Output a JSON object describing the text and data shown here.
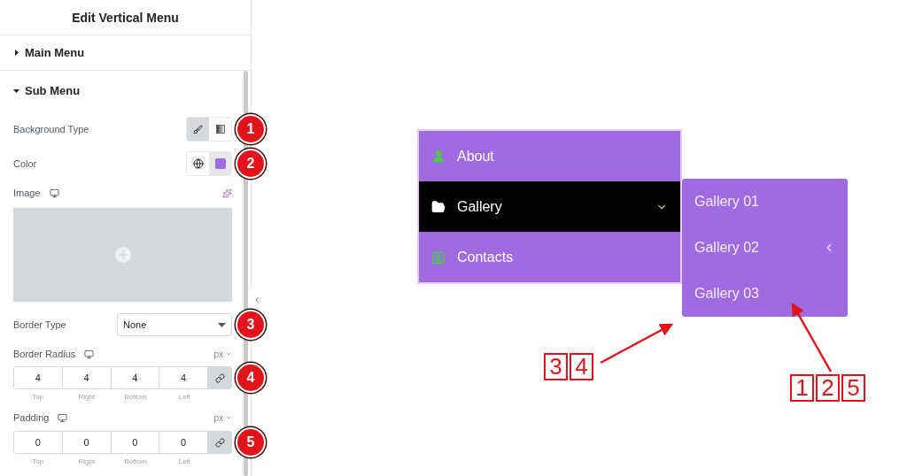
{
  "panel": {
    "title": "Edit Vertical Menu",
    "sections": [
      {
        "title": "Main Menu",
        "expanded": false
      },
      {
        "title": "Sub Menu",
        "expanded": true
      }
    ],
    "background_type": {
      "label": "Background Type",
      "options": [
        {
          "kind": "classic",
          "selected": true
        },
        {
          "kind": "gradient",
          "selected": false
        }
      ],
      "badge": "1"
    },
    "color": {
      "label": "Color",
      "badge": "2"
    },
    "image": {
      "label": "Image"
    },
    "border_type": {
      "label": "Border Type",
      "value": "None",
      "badge": "3"
    },
    "border_radius": {
      "label": "Border Radius",
      "unit": "px",
      "linked": true,
      "badge": "4",
      "values": [
        {
          "value": "4",
          "label": "Top"
        },
        {
          "value": "4",
          "label": "Right"
        },
        {
          "value": "4",
          "label": "Bottom"
        },
        {
          "value": "4",
          "label": "Left"
        }
      ]
    },
    "padding": {
      "label": "Padding",
      "unit": "px",
      "linked": true,
      "badge": "5",
      "values": [
        {
          "value": "0",
          "label": "Top"
        },
        {
          "value": "0",
          "label": "Right"
        },
        {
          "value": "0",
          "label": "Bottom"
        },
        {
          "value": "0",
          "label": "Left"
        }
      ]
    }
  },
  "preview": {
    "menu": [
      {
        "label": "About",
        "kind": "person",
        "selected": false
      },
      {
        "label": "Gallery",
        "kind": "folder",
        "selected": true
      },
      {
        "label": "Contacts",
        "kind": "contact",
        "selected": false
      }
    ],
    "submenu": [
      {
        "label": "Gallery 01",
        "expandable": false
      },
      {
        "label": "Gallery 02",
        "expandable": true
      },
      {
        "label": "Gallery 03",
        "expandable": false
      }
    ],
    "annotations": [
      {
        "labels": [
          "3",
          "4"
        ]
      },
      {
        "labels": [
          "1",
          "2",
          "5"
        ]
      }
    ]
  }
}
